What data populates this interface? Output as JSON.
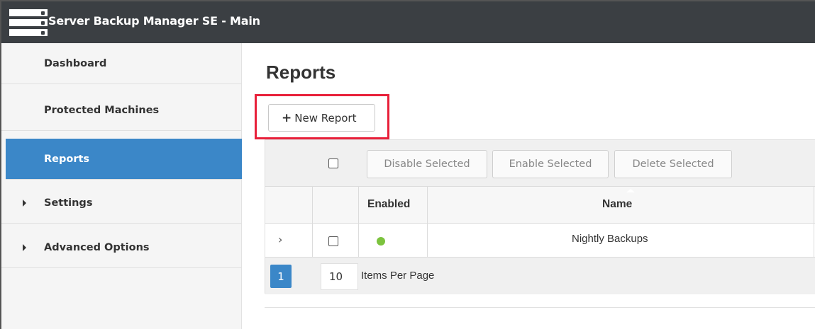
{
  "app": {
    "title": "Server Backup Manager SE - Main"
  },
  "sidebar": {
    "items": [
      {
        "label": "Dashboard",
        "active": false,
        "expandable": false
      },
      {
        "label": "Protected Machines",
        "active": false,
        "expandable": false
      },
      {
        "label": "Reports",
        "active": true,
        "expandable": false
      },
      {
        "label": "Settings",
        "active": false,
        "expandable": true
      },
      {
        "label": "Advanced Options",
        "active": false,
        "expandable": true
      }
    ]
  },
  "main": {
    "page_title": "Reports",
    "new_report_label": "New Report",
    "toolbar": {
      "disable_label": "Disable Selected",
      "enable_label": "Enable Selected",
      "delete_label": "Delete Selected"
    },
    "table": {
      "columns": [
        "Enabled",
        "Name"
      ],
      "rows": [
        {
          "enabled": true,
          "name": "Nightly Backups"
        }
      ]
    },
    "pager": {
      "current_page": "1",
      "items_per_page": "10",
      "items_per_page_label": "Items Per Page"
    }
  },
  "colors": {
    "titlebar": "#3b3f43",
    "accent": "#3b87c8",
    "highlight": "#e8203a",
    "enabled_dot": "#7cc33e"
  }
}
